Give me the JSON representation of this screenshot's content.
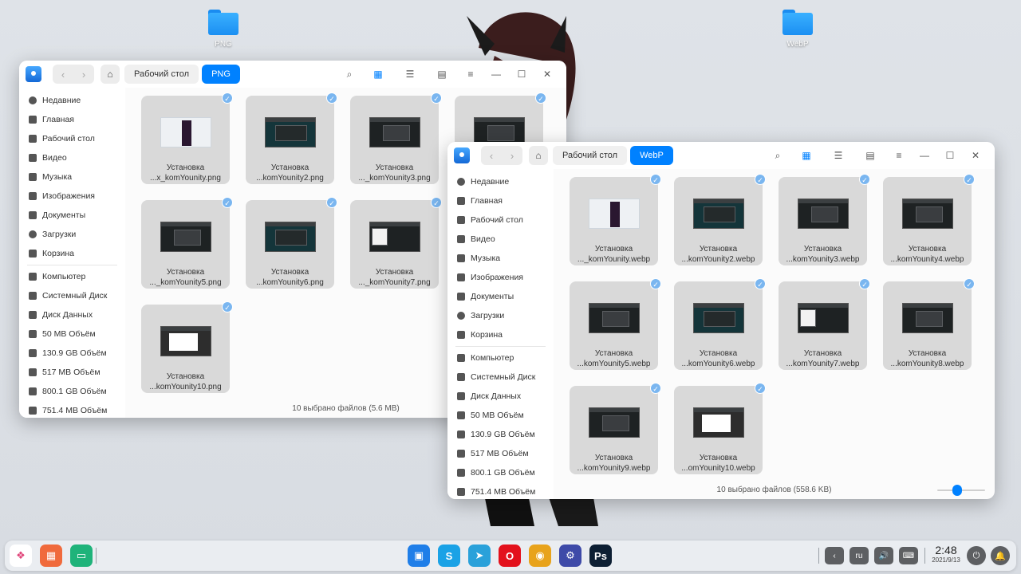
{
  "desktop": {
    "icons": [
      {
        "label": "PNG"
      },
      {
        "label": "WebP"
      }
    ]
  },
  "window1": {
    "back_glyph": "‹",
    "forward_glyph": "›",
    "home_glyph": "⌂",
    "breadcrumbs": [
      "Рабочий стол",
      "PNG"
    ],
    "status": "10 выбрано файлов (5.6 MB)",
    "files": [
      {
        "line1": "Установка",
        "line2": "...x_komYounity.png",
        "thumb": "t1"
      },
      {
        "line1": "Установка",
        "line2": "...komYounity2.png",
        "thumb": "t2"
      },
      {
        "line1": "Установка",
        "line2": "..._komYounity3.png",
        "thumb": "t3"
      },
      {
        "line1": "Установка",
        "line2": "...komYounity4.png",
        "thumb": "t3"
      },
      {
        "line1": "Установка",
        "line2": "..._komYounity5.png",
        "thumb": "t3"
      },
      {
        "line1": "Установка",
        "line2": "...komYounity6.png",
        "thumb": "t2"
      },
      {
        "line1": "Установка",
        "line2": "..._komYounity7.png",
        "thumb": "t7"
      },
      {
        "line1": "Установка",
        "line2": "..._komYounity9.png",
        "thumb": "t3"
      },
      {
        "line1": "Установка",
        "line2": "...komYounity10.png",
        "thumb": "t10"
      }
    ]
  },
  "window2": {
    "back_glyph": "‹",
    "forward_glyph": "›",
    "home_glyph": "⌂",
    "breadcrumbs": [
      "Рабочий стол",
      "WebP"
    ],
    "status": "10 выбрано файлов (558.6 KB)",
    "files": [
      {
        "line1": "Установка",
        "line2": "..._komYounity.webp",
        "thumb": "t1"
      },
      {
        "line1": "Установка",
        "line2": "...komYounity2.webp",
        "thumb": "t2"
      },
      {
        "line1": "Установка",
        "line2": "...komYounity3.webp",
        "thumb": "t3"
      },
      {
        "line1": "Установка",
        "line2": "...komYounity4.webp",
        "thumb": "t3"
      },
      {
        "line1": "Установка",
        "line2": "...komYounity5.webp",
        "thumb": "t3"
      },
      {
        "line1": "Установка",
        "line2": "...komYounity6.webp",
        "thumb": "t2"
      },
      {
        "line1": "Установка",
        "line2": "...komYounity7.webp",
        "thumb": "t7"
      },
      {
        "line1": "Установка",
        "line2": "...komYounity8.webp",
        "thumb": "t3"
      },
      {
        "line1": "Установка",
        "line2": "...komYounity9.webp",
        "thumb": "t3"
      },
      {
        "line1": "Установка",
        "line2": "...omYounity10.webp",
        "thumb": "t10"
      }
    ],
    "zoom_level": 0.4
  },
  "sidebar": {
    "items": [
      {
        "label": "Недавние",
        "icon": "clock-icon"
      },
      {
        "label": "Главная",
        "icon": "home-icon"
      },
      {
        "label": "Рабочий стол",
        "icon": "desktop-icon"
      },
      {
        "label": "Видео",
        "icon": "video-icon"
      },
      {
        "label": "Музыка",
        "icon": "music-icon"
      },
      {
        "label": "Изображения",
        "icon": "image-icon"
      },
      {
        "label": "Документы",
        "icon": "document-icon"
      },
      {
        "label": "Загрузки",
        "icon": "download-icon"
      },
      {
        "label": "Корзина",
        "icon": "trash-icon"
      }
    ],
    "devices": [
      {
        "label": "Компьютер",
        "icon": "computer-icon"
      },
      {
        "label": "Системный Диск",
        "icon": "disk-icon"
      },
      {
        "label": "Диск Данных",
        "icon": "disk-icon"
      },
      {
        "label": "50 MB Объём",
        "icon": "disk-icon"
      },
      {
        "label": "130.9 GB Объём",
        "icon": "disk-icon"
      },
      {
        "label": "517 MB Объём",
        "icon": "disk-icon"
      },
      {
        "label": "800.1 GB Объём",
        "icon": "disk-icon"
      },
      {
        "label": "751.4 MB Объём",
        "icon": "disk-icon"
      }
    ]
  },
  "toolbar": {
    "icons": [
      "search-icon",
      "grid-view-icon",
      "list-view-icon",
      "details-view-icon",
      "menu-icon",
      "minimize-icon",
      "maximize-icon",
      "close-icon"
    ],
    "glyphs": [
      "⌕",
      "▦",
      "☰",
      "▤",
      "≡",
      "—",
      "☐",
      "✕"
    ]
  },
  "check_glyph": "✓",
  "dock": {
    "tray": {
      "back": "‹",
      "lang": "ru",
      "volume": "🔊",
      "keyboard": "⌨"
    },
    "clock_time": "2:48",
    "clock_date": "2021/9/13",
    "power": "⏻",
    "notify": "🔔",
    "apps": [
      {
        "name": "launcher-icon",
        "color": "#ffffff",
        "glyph": "❖"
      },
      {
        "name": "multitask-icon",
        "color": "#f06a3c",
        "glyph": "▦"
      },
      {
        "name": "desktop-switch-icon",
        "color": "#1fb37a",
        "glyph": "▭"
      },
      {
        "name": "file-manager-icon",
        "color": "#1f7ee8",
        "glyph": "▣"
      },
      {
        "name": "skype-icon",
        "color": "#1aa2e6",
        "glyph": "S"
      },
      {
        "name": "telegram-icon",
        "color": "#2aa1da",
        "glyph": "➤"
      },
      {
        "name": "opera-icon",
        "color": "#e3111c",
        "glyph": "O"
      },
      {
        "name": "chrome-icon",
        "color": "#e8a31c",
        "glyph": "◉"
      },
      {
        "name": "settings-icon",
        "color": "#3e4aa8",
        "glyph": "⚙"
      },
      {
        "name": "photoshop-icon",
        "color": "#0d1f33",
        "glyph": "Ps"
      }
    ]
  }
}
